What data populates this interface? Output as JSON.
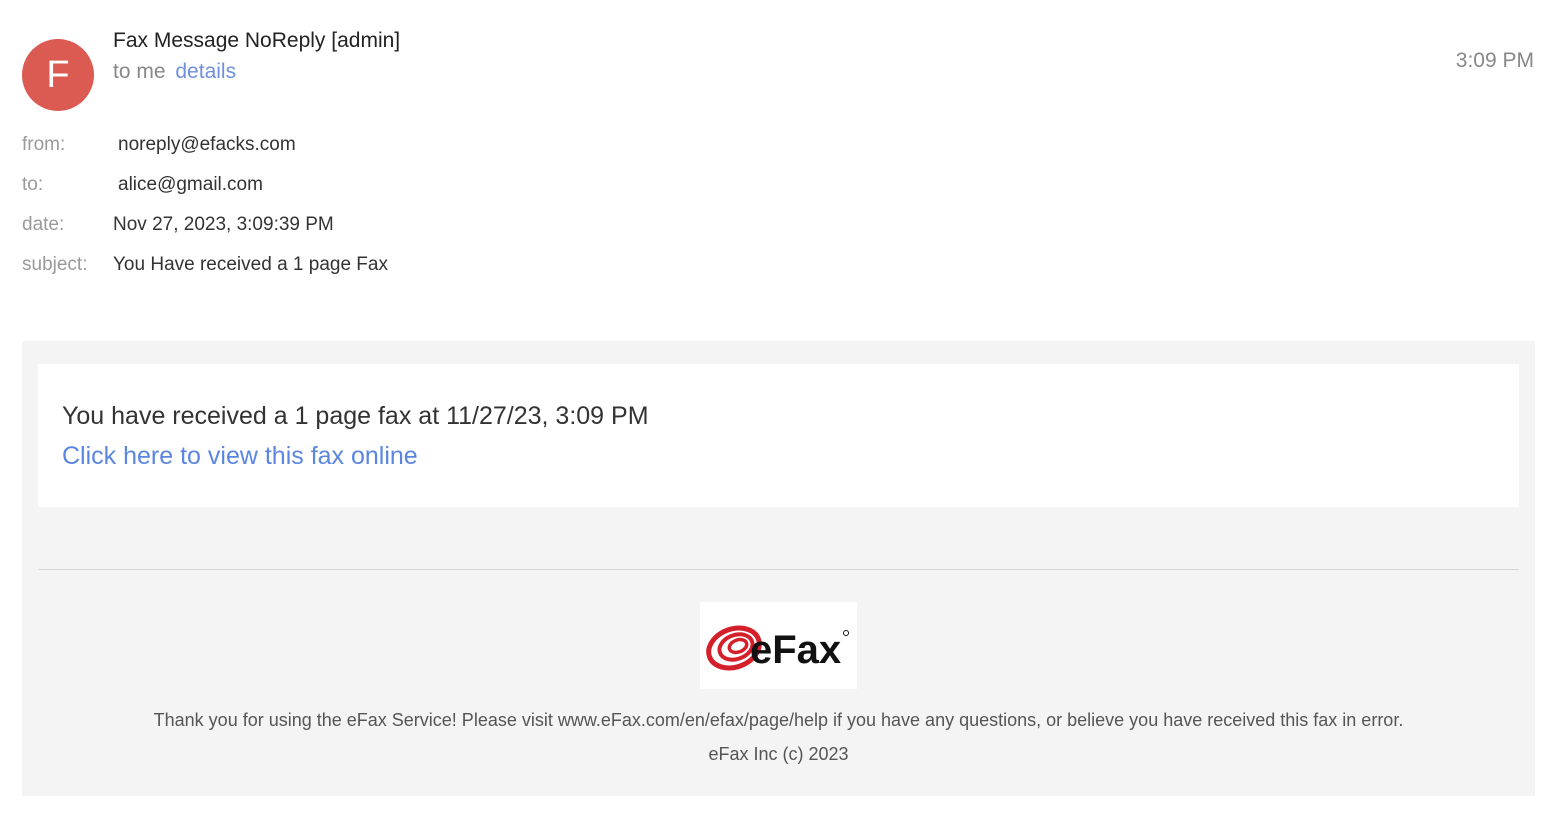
{
  "header": {
    "avatar_letter": "F",
    "avatar_color": "#db5a52",
    "sender_name": "Fax Message NoReply [admin]",
    "to_me": "to me",
    "details_label": "details",
    "time": "3:09 PM"
  },
  "meta": {
    "from_label": "from:",
    "from_value": "noreply@efacks.com",
    "to_label": "to:",
    "to_value": "alice@gmail.com",
    "date_label": "date:",
    "date_value": "Nov 27, 2023, 3:09:39 PM",
    "subject_label": "subject:",
    "subject_value": "You Have received a 1 page Fax"
  },
  "body": {
    "fax_notice": "You have received a 1 page fax at 11/27/23, 3:09 PM",
    "view_link": "Click here to view this fax online",
    "logo_text": "eFax",
    "footer_text": "Thank you for using the eFax Service! Please visit www.eFax.com/en/efax/page/help if you have any questions, or believe you have received this fax in error.",
    "copyright": "eFax Inc (c) 2023"
  },
  "colors": {
    "link": "#5b86e0",
    "panel_bg": "#f4f4f4",
    "logo_red": "#d3202a"
  }
}
